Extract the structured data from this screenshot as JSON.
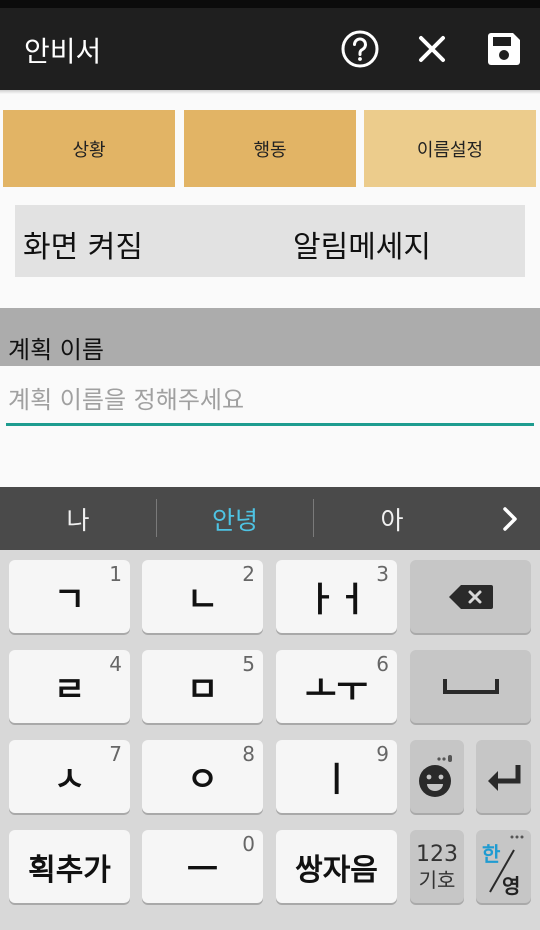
{
  "app": {
    "title": "안비서",
    "icons": {
      "help": "help-circle-icon",
      "close": "close-icon",
      "save": "save-icon"
    }
  },
  "tabs": [
    {
      "label": "상황"
    },
    {
      "label": "행동"
    },
    {
      "label": "이름설정"
    }
  ],
  "summary": {
    "condition": "화면 켜짐",
    "action": "알림메세지"
  },
  "plan_name": {
    "header": "계획 이름",
    "value": "",
    "placeholder": "계획 이름을 정해주세요"
  },
  "colors": {
    "appbar": "#1f1f1f",
    "tab": "#e2b465",
    "tab_active": "#eccc8c",
    "input_underline": "#1d9c8f",
    "suggestion_highlight": "#4ec3e3"
  },
  "keyboard": {
    "suggestions": [
      "나",
      "안녕",
      "아"
    ],
    "suggestion_next_icon": "chevron-right-icon",
    "rows": [
      [
        {
          "label": "ㄱ",
          "num": "1"
        },
        {
          "label": "ㄴ",
          "num": "2"
        },
        {
          "label": "ㅏㅓ",
          "num": "3"
        },
        {
          "label": "backspace",
          "icon": "backspace-icon"
        }
      ],
      [
        {
          "label": "ㄹ",
          "num": "4"
        },
        {
          "label": "ㅁ",
          "num": "5"
        },
        {
          "label": "ㅗㅜ",
          "num": "6"
        },
        {
          "label": "space",
          "icon": "space-bar-icon"
        }
      ],
      [
        {
          "label": "ㅅ",
          "num": "7"
        },
        {
          "label": "ㅇ",
          "num": "8"
        },
        {
          "label": "ㅣ",
          "num": "9"
        },
        {
          "label": "emoji",
          "icon": "emoji-mic-icon"
        },
        {
          "label": "enter",
          "icon": "enter-icon"
        }
      ],
      [
        {
          "label": "획추가"
        },
        {
          "label": "ㅡ",
          "num": "0"
        },
        {
          "label": "쌍자음"
        },
        {
          "label": "123",
          "sub": "기호"
        },
        {
          "label": "한",
          "sub": "영"
        }
      ]
    ]
  }
}
